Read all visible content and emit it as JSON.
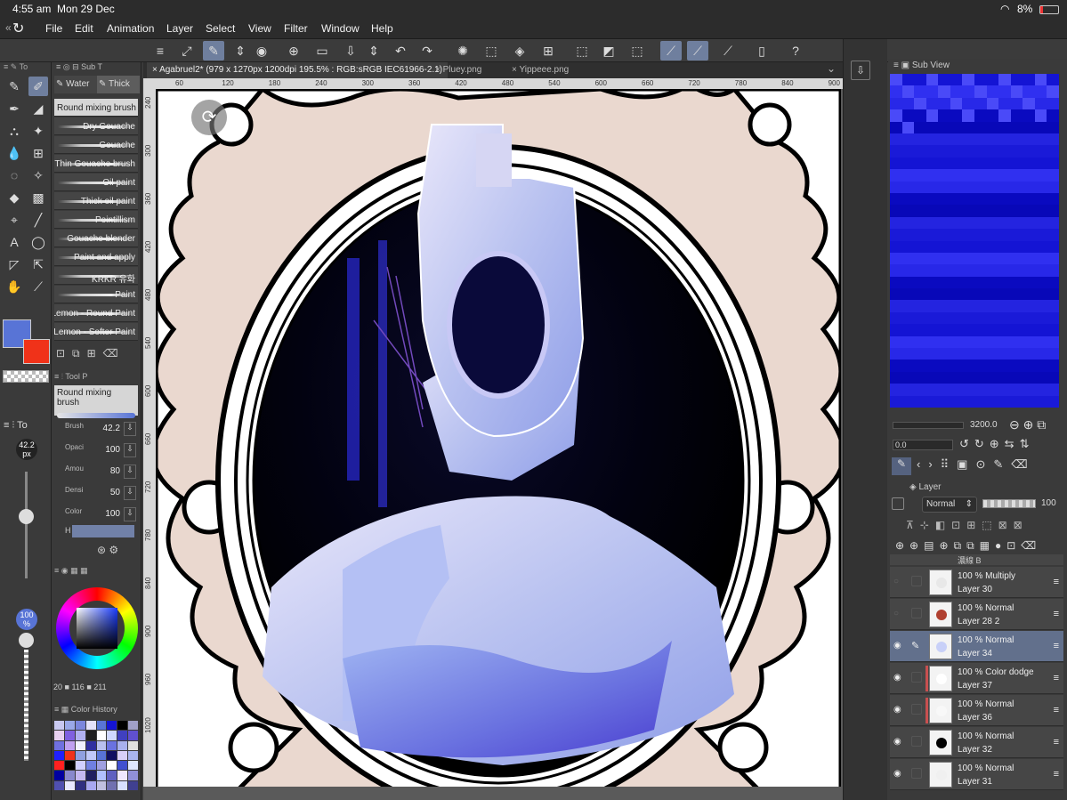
{
  "status": {
    "time": "4:55 am",
    "date": "Mon 29 Dec",
    "battery": "8%"
  },
  "menu": [
    "File",
    "Edit",
    "Animation",
    "Layer",
    "Select",
    "View",
    "Filter",
    "Window",
    "Help"
  ],
  "tabs": [
    {
      "label": "Agabruel2* (979 x 1270px 1200dpi 195.5% : RGB:sRGB IEC61966-2.1)",
      "active": true
    },
    {
      "label": "Pluey.png",
      "active": false
    },
    {
      "label": "Yippeee.png",
      "active": false
    }
  ],
  "ruler_top": [
    "60",
    "120",
    "180",
    "240",
    "300",
    "360",
    "420",
    "480",
    "540",
    "600",
    "660",
    "720",
    "780",
    "840",
    "900"
  ],
  "ruler_left": [
    "240",
    "300",
    "360",
    "420",
    "480",
    "540",
    "600",
    "660",
    "720",
    "780",
    "840",
    "900",
    "960",
    "1020"
  ],
  "subtool": {
    "tabs": [
      "Water",
      "Thick"
    ],
    "header": "Sub T",
    "brushes": [
      "Round mixing brush",
      "Dry Gouache",
      "Gouache",
      "Thin Gouache brush",
      "Oil paint",
      "Thick oil paint",
      "Pointillism",
      "Gouache blender",
      "Paint and apply",
      "KRKR 유화",
      "Paint",
      "Lemon - Round Paint",
      "Lemon - Softer Paint"
    ]
  },
  "tool_property": {
    "title": "Tool P",
    "brush_name": "Round mixing brush",
    "props": [
      {
        "label": "Brush",
        "value": "42.2"
      },
      {
        "label": "Opaci",
        "value": "100"
      },
      {
        "label": "Amou",
        "value": "80"
      },
      {
        "label": "Densi",
        "value": "50"
      },
      {
        "label": "Color",
        "value": "100"
      }
    ],
    "h_label": "H"
  },
  "left_slider": {
    "size_label": "42.2",
    "size_unit": "px",
    "opacity_label": "100",
    "opacity_unit": "%"
  },
  "color_wheel": {
    "values": [
      "116",
      "211"
    ],
    "label_prefix": "20"
  },
  "color_history": {
    "title": "Color History"
  },
  "colors": {
    "main": "#5874d6",
    "sub": "#f03219"
  },
  "subview": {
    "title": "Sub View",
    "zoom": "3200.0",
    "angle": "0.0"
  },
  "layer_panel": {
    "title": "Layer",
    "blend": "Normal",
    "opacity": "100",
    "layers": [
      {
        "pct": "100 %",
        "mode": "Multiply",
        "name": "Layer 30",
        "visible": false,
        "selected": false
      },
      {
        "pct": "100 %",
        "mode": "Normal",
        "name": "Layer 28 2",
        "visible": false,
        "selected": false
      },
      {
        "pct": "100 %",
        "mode": "Normal",
        "name": "Layer 34",
        "visible": true,
        "selected": true
      },
      {
        "pct": "100 %",
        "mode": "Color dodge",
        "name": "Layer 37",
        "visible": true,
        "selected": false
      },
      {
        "pct": "100 %",
        "mode": "Normal",
        "name": "Layer 36",
        "visible": true,
        "selected": false
      },
      {
        "pct": "100 %",
        "mode": "Normal",
        "name": "Layer 32",
        "visible": true,
        "selected": false
      },
      {
        "pct": "100 %",
        "mode": "Normal",
        "name": "Layer 31",
        "visible": true,
        "selected": false
      }
    ],
    "top_partial": "濃線 B"
  }
}
